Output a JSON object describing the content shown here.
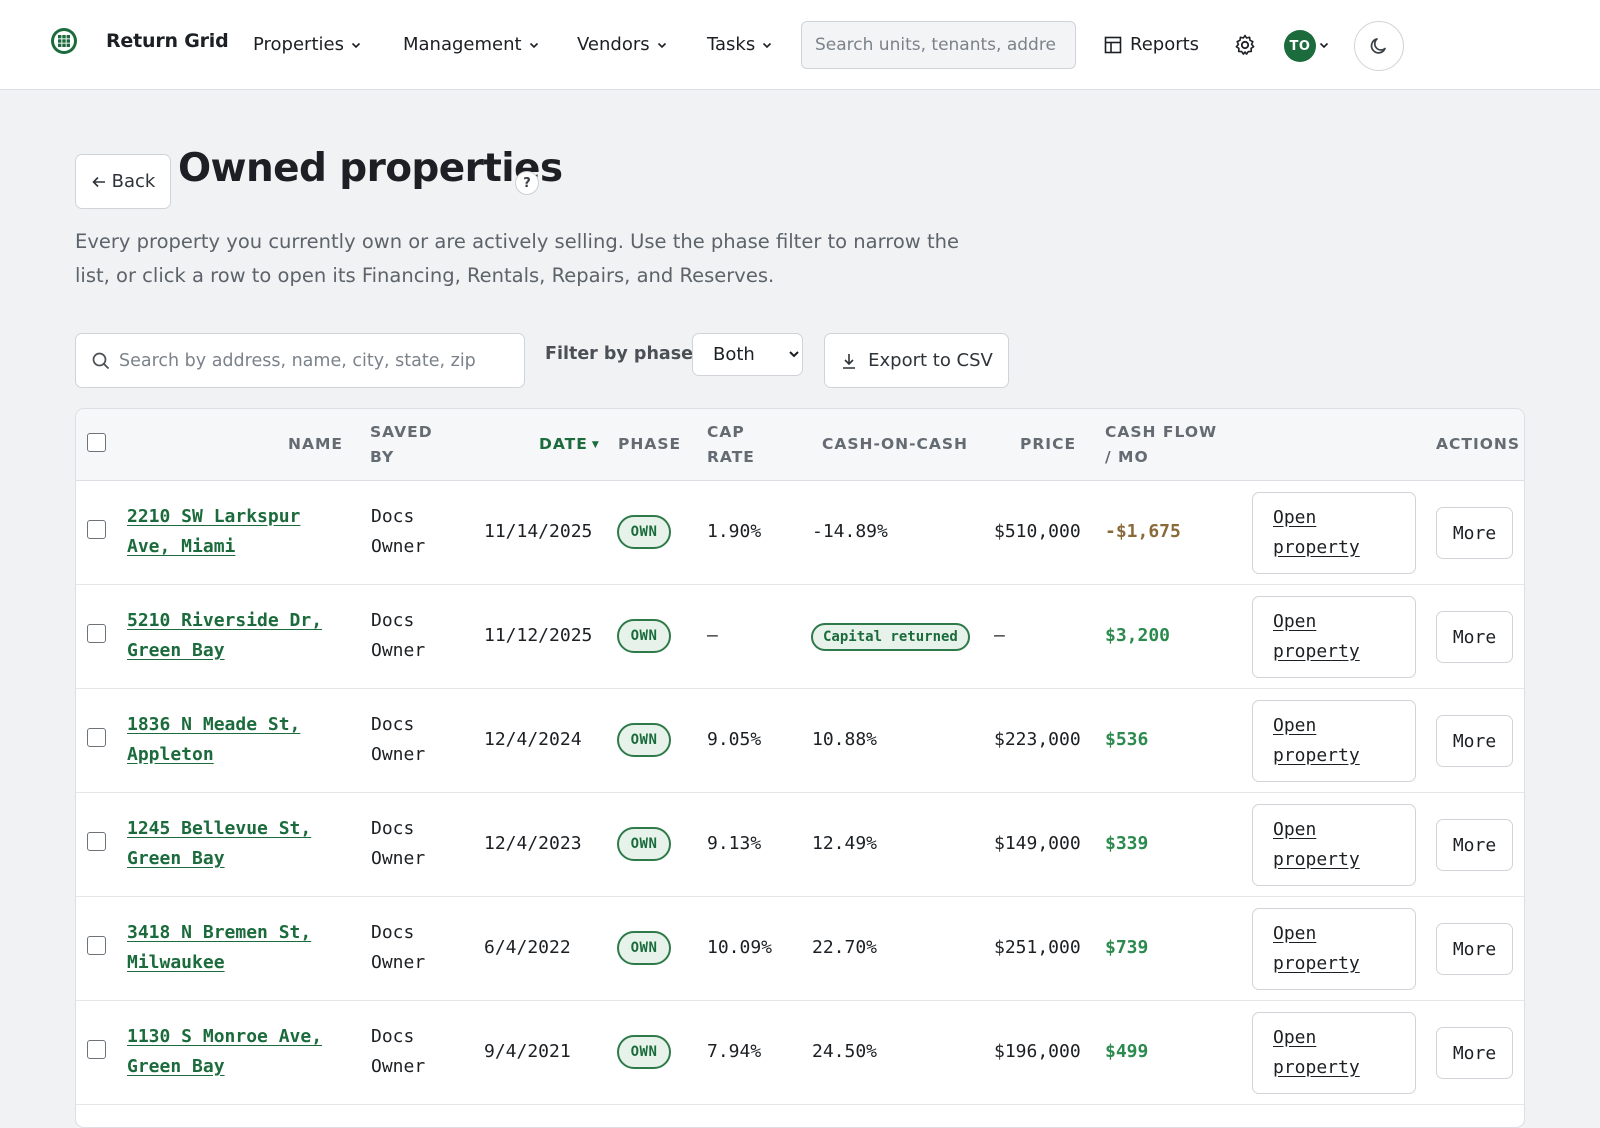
{
  "app": {
    "brand": "Return Grid"
  },
  "nav": {
    "properties": "Properties",
    "management": "Management",
    "vendors": "Vendors",
    "tasks": "Tasks",
    "search_placeholder": "Search units, tenants, addre",
    "reports": "Reports",
    "avatar_initials": "TO"
  },
  "header": {
    "back_label": "Back",
    "title": "Owned properties",
    "help": "?",
    "description": "Every property you currently own or are actively selling. Use the phase filter to narrow the list, or click a row to open its Financing, Rentals, Repairs, and Reserves."
  },
  "filters": {
    "search_placeholder": "Search by address, name, city, state, zip",
    "phase_label": "Filter by phase",
    "phase_value": "Both",
    "export_label": "Export to CSV"
  },
  "table": {
    "headers": {
      "name": "NAME",
      "saved_by": "SAVED BY",
      "date": "DATE",
      "phase": "PHASE",
      "cap_rate": "CAP RATE",
      "cash_on_cash": "CASH-ON-CASH",
      "price": "PRICE",
      "cash_flow": "CASH FLOW / MO",
      "actions": "ACTIONS"
    },
    "rows": [
      {
        "name_line1": "2210 SW Larkspur",
        "name_line2": "Ave, Miami",
        "saved_line1": "Docs",
        "saved_line2": "Owner",
        "date": "11/14/2025",
        "phase": "OWN",
        "cap_rate": "1.90%",
        "coc": "-14.89%",
        "coc_badge": "",
        "price": "$510,000",
        "cash_flow": "-$1,675",
        "cf_negative": true,
        "open_line1": "Open",
        "open_line2": "property",
        "more": "More"
      },
      {
        "name_line1": "5210 Riverside Dr,",
        "name_line2": "Green Bay",
        "saved_line1": "Docs",
        "saved_line2": "Owner",
        "date": "11/12/2025",
        "phase": "OWN",
        "cap_rate": "—",
        "coc": "",
        "coc_badge": "Capital returned",
        "price": "—",
        "cash_flow": "$3,200",
        "cf_negative": false,
        "open_line1": "Open",
        "open_line2": "property",
        "more": "More"
      },
      {
        "name_line1": "1836 N Meade St,",
        "name_line2": "Appleton",
        "saved_line1": "Docs",
        "saved_line2": "Owner",
        "date": "12/4/2024",
        "phase": "OWN",
        "cap_rate": "9.05%",
        "coc": "10.88%",
        "coc_badge": "",
        "price": "$223,000",
        "cash_flow": "$536",
        "cf_negative": false,
        "open_line1": "Open",
        "open_line2": "property",
        "more": "More"
      },
      {
        "name_line1": "1245 Bellevue St,",
        "name_line2": "Green Bay",
        "saved_line1": "Docs",
        "saved_line2": "Owner",
        "date": "12/4/2023",
        "phase": "OWN",
        "cap_rate": "9.13%",
        "coc": "12.49%",
        "coc_badge": "",
        "price": "$149,000",
        "cash_flow": "$339",
        "cf_negative": false,
        "open_line1": "Open",
        "open_line2": "property",
        "more": "More"
      },
      {
        "name_line1": "3418 N Bremen St,",
        "name_line2": "Milwaukee",
        "saved_line1": "Docs",
        "saved_line2": "Owner",
        "date": "6/4/2022",
        "phase": "OWN",
        "cap_rate": "10.09%",
        "coc": "22.70%",
        "coc_badge": "",
        "price": "$251,000",
        "cash_flow": "$739",
        "cf_negative": false,
        "open_line1": "Open",
        "open_line2": "property",
        "more": "More"
      },
      {
        "name_line1": "1130 S Monroe Ave,",
        "name_line2": "Green Bay",
        "saved_line1": "Docs",
        "saved_line2": "Owner",
        "date": "9/4/2021",
        "phase": "OWN",
        "cap_rate": "7.94%",
        "coc": "24.50%",
        "coc_badge": "",
        "price": "$196,000",
        "cash_flow": "$499",
        "cf_negative": false,
        "open_line1": "Open",
        "open_line2": "property",
        "more": "More"
      }
    ]
  },
  "colors": {
    "accent": "#1b6b3c",
    "cash_positive": "#2c8a4e",
    "cash_negative": "#8a6a3a"
  }
}
